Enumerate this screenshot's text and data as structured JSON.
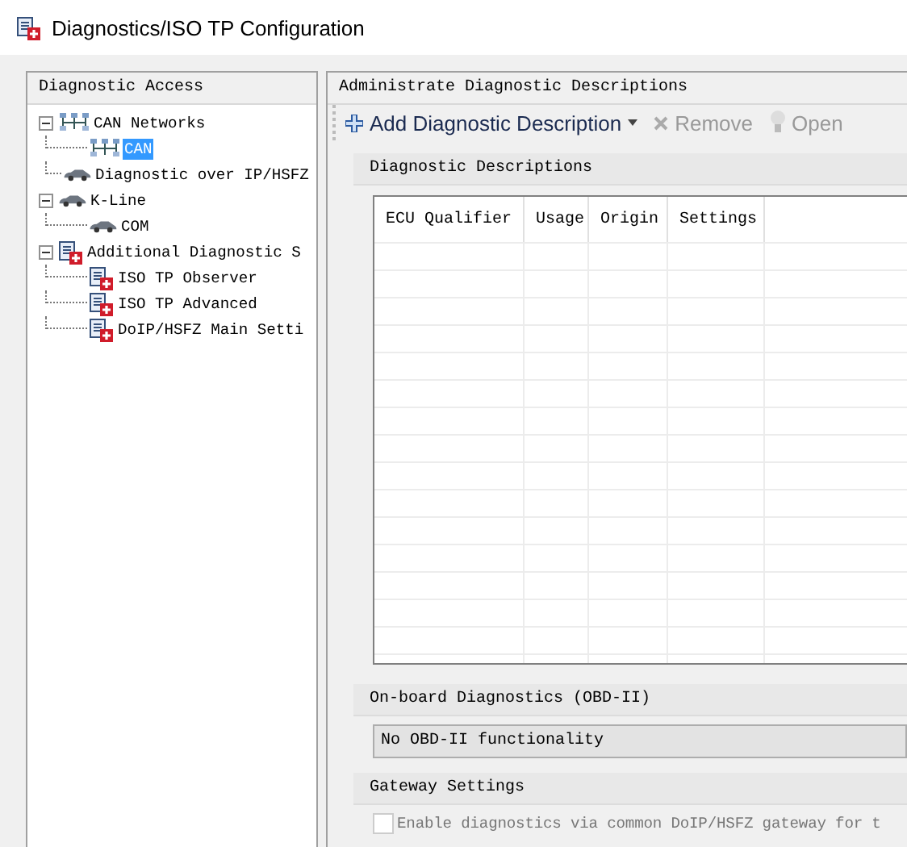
{
  "window": {
    "title": "Diagnostics/ISO TP Configuration"
  },
  "left_panel": {
    "title": "Diagnostic Access",
    "tree": [
      {
        "label": "CAN Networks",
        "kind": "network",
        "expanded": true,
        "selected": false,
        "children": [
          {
            "label": "CAN",
            "kind": "network",
            "selected": true
          }
        ]
      },
      {
        "label": "Diagnostic over IP/HSFZ",
        "kind": "car",
        "selected": false
      },
      {
        "label": "K-Line",
        "kind": "car",
        "expanded": true,
        "selected": false,
        "children": [
          {
            "label": "COM",
            "kind": "car",
            "selected": false
          }
        ]
      },
      {
        "label": "Additional Diagnostic S",
        "kind": "doc",
        "expanded": true,
        "selected": false,
        "children": [
          {
            "label": "ISO TP Observer",
            "kind": "doc",
            "selected": false
          },
          {
            "label": "ISO TP Advanced",
            "kind": "doc",
            "selected": false
          },
          {
            "label": "DoIP/HSFZ Main Setti",
            "kind": "doc",
            "selected": false
          }
        ]
      }
    ]
  },
  "right_panel": {
    "title": "Administrate Diagnostic Descriptions",
    "toolbar": [
      {
        "label": "Add Diagnostic Description",
        "kind": "add",
        "disabled": false
      },
      {
        "label": "Remove",
        "kind": "remove",
        "disabled": true
      },
      {
        "label": "Open",
        "kind": "open",
        "disabled": true
      }
    ],
    "descriptions": {
      "title": "Diagnostic Descriptions",
      "columns": [
        "ECU Qualifier",
        "Usage",
        "Origin",
        "Settings"
      ]
    },
    "obd": {
      "title": "On-board Diagnostics (OBD-II)",
      "value": "No OBD-II functionality"
    },
    "gateway": {
      "title": "Gateway Settings",
      "checkbox": {
        "label": "Enable diagnostics via common DoIP/HSFZ gateway for t",
        "checked": false,
        "disabled": true
      }
    }
  }
}
